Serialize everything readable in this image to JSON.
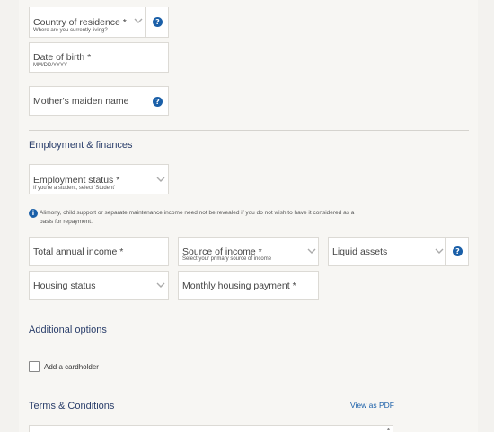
{
  "personal": {
    "country": {
      "label": "Country of residence *",
      "hint": "Where are you currently living?"
    },
    "dob": {
      "label": "Date of birth *",
      "hint": "MM/DD/YYYY"
    },
    "maiden": {
      "label": "Mother's maiden name"
    }
  },
  "employment": {
    "title": "Employment & finances",
    "status": {
      "label": "Employment status *",
      "hint": "If you're a student, select 'Student'"
    },
    "note": "Alimony, child support or separate maintenance income need not be revealed if you do not wish to have it considered as a basis for repayment.",
    "income": {
      "label": "Total annual income *"
    },
    "source": {
      "label": "Source of income *",
      "hint": "Select your primary source of income"
    },
    "liquid": {
      "label": "Liquid assets"
    },
    "housing_status": {
      "label": "Housing status"
    },
    "housing_payment": {
      "label": "Monthly housing payment *"
    }
  },
  "additional": {
    "title": "Additional options",
    "cardholder_label": "Add a cardholder"
  },
  "terms": {
    "title": "Terms & Conditions",
    "pdf_link": "View as PDF"
  },
  "icons": {
    "help": "question-mark-icon",
    "info": "info-icon",
    "chevron": "chevron-down-icon"
  },
  "colors": {
    "accent": "#1a5fa8",
    "heading": "#2b3f6b"
  }
}
